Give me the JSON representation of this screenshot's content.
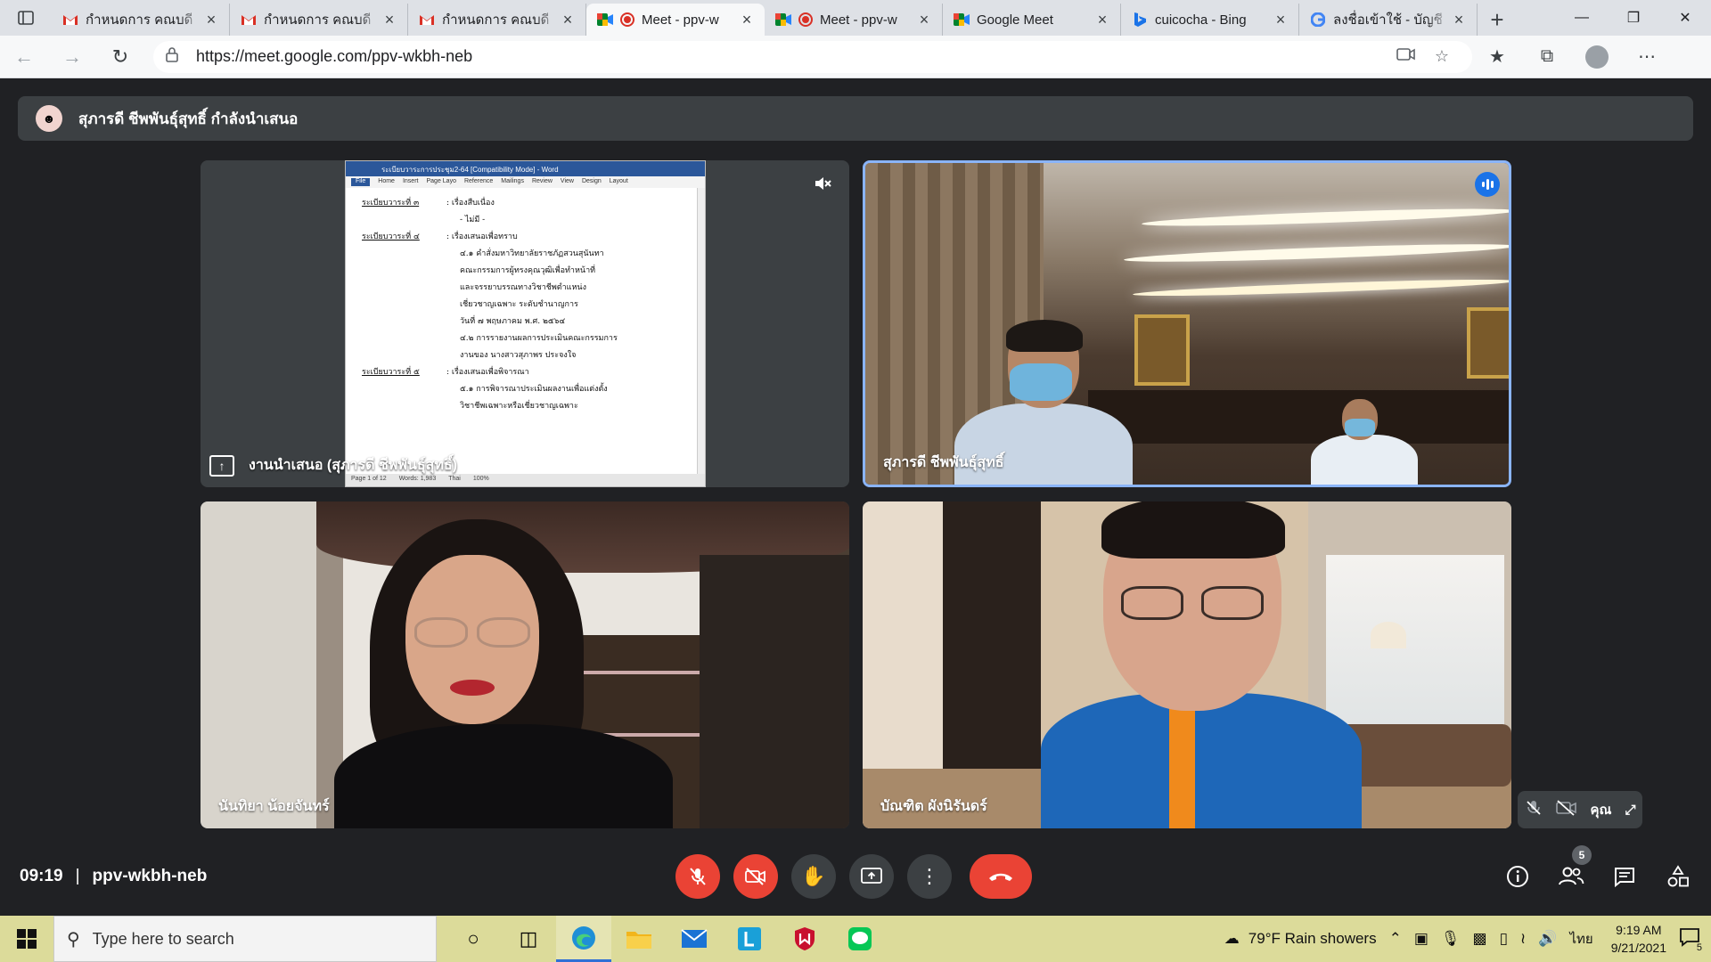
{
  "browser": {
    "tabs": [
      {
        "icon": "gmail-icon",
        "title": "กำหนดการ คณบดี",
        "active": false
      },
      {
        "icon": "gmail-icon",
        "title": "กำหนดการ คณบดี",
        "active": false
      },
      {
        "icon": "gmail-icon",
        "title": "กำหนดการ คณบดี",
        "active": false
      },
      {
        "icon": "meet-icon",
        "title": "Meet - ppv-w",
        "active": true,
        "recording": true
      },
      {
        "icon": "meet-icon",
        "title": "Meet - ppv-w",
        "active": false,
        "recording": true
      },
      {
        "icon": "meet-icon",
        "title": "Google Meet",
        "active": false
      },
      {
        "icon": "bing-icon",
        "title": "cuicocha - Bing",
        "active": false
      },
      {
        "icon": "google-icon",
        "title": "ลงชื่อเข้าใช้ - บัญชี",
        "active": false
      }
    ],
    "url": "https://meet.google.com/ppv-wkbh-neb"
  },
  "meet": {
    "presenting_banner": "สุภารดี ชีพพันธุ์สุทธิ์ กำลังนำเสนอ",
    "presentation_label": "งานนำเสนอ (สุภารดี ชีพพันธุ์สุทธิ์)",
    "document": {
      "window_title": "ระเบียบวาระการประชุม2-64 [Compatibility Mode] - Word",
      "ribbon": [
        "File",
        "Home",
        "Insert",
        "Page Layo",
        "Reference",
        "Mailings",
        "Review",
        "View",
        "Design",
        "Layout"
      ],
      "lines": [
        {
          "key": "ระเบียบวาระที่ ๓",
          "val": ": เรื่องสืบเนื่อง"
        },
        {
          "key": "",
          "val": "- ไม่มี -"
        },
        {
          "key": "ระเบียบวาระที่ ๔",
          "val": ": เรื่องเสนอเพื่อทราบ"
        },
        {
          "key": "",
          "val": "๔.๑ คำสั่งมหาวิทยาลัยราชภัฏสวนสุนันทา"
        },
        {
          "key": "",
          "val": "คณะกรรมการผู้ทรงคุณวุฒิเพื่อทำหน้าที่"
        },
        {
          "key": "",
          "val": "และจรรยาบรรณทางวิชาชีพตำแหน่ง"
        },
        {
          "key": "",
          "val": "เชี่ยวชาญเฉพาะ ระดับชำนาญการ"
        },
        {
          "key": "",
          "val": "วันที่ ๗ พฤษภาคม พ.ศ. ๒๕๖๔"
        },
        {
          "key": "",
          "val": "๔.๒ การรายงานผลการประเมินคณะกรรมการ"
        },
        {
          "key": "",
          "val": "งานของ นางสาวสุภาพร ประจงใจ"
        },
        {
          "key": "ระเบียบวาระที่ ๕",
          "val": ": เรื่องเสนอเพื่อพิจารณา"
        },
        {
          "key": "",
          "val": "๕.๑ การพิจารณาประเมินผลงานเพื่อแต่งตั้ง"
        },
        {
          "key": "",
          "val": "วิชาชีพเฉพาะหรือเชี่ยวชาญเฉพาะ"
        }
      ],
      "status": [
        "Page 1 of 12",
        "Words: 1,983",
        "Thai",
        "100%"
      ]
    },
    "participants": [
      {
        "id": "speaker",
        "name": "สุภารดี ชีพพันธุ์สุทธิ์",
        "speaking": true
      },
      {
        "id": "nanthiya",
        "name": "นันทิยา น้อยจันทร์"
      },
      {
        "id": "bandit",
        "name": "บัณฑิต ผังนิรันดร์"
      }
    ],
    "self_label": "คุณ",
    "time": "09:19",
    "meeting_code": "ppv-wkbh-neb",
    "participant_count": "5"
  },
  "taskbar": {
    "search_placeholder": "Type here to search",
    "weather": "79°F  Rain showers",
    "language": "ไทย",
    "time": "9:19 AM",
    "date": "9/21/2021",
    "notification_count": "5"
  }
}
